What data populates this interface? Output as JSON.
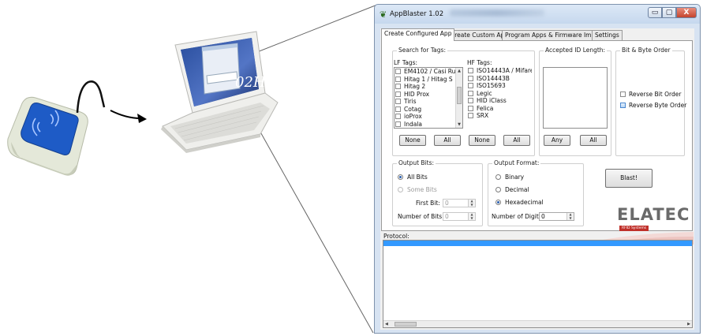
{
  "window": {
    "title": "AppBlaster 1.02",
    "controls": {
      "minimize": "▭",
      "maximize": "▢",
      "close": "X"
    }
  },
  "tabs": [
    {
      "label": "Create Configured App",
      "active": true
    },
    {
      "label": "Create Custom App",
      "active": false
    },
    {
      "label": "Program Apps & Firmware Images",
      "active": false
    },
    {
      "label": "Settings",
      "active": false
    }
  ],
  "search_tags": {
    "group_label": "Search for Tags:",
    "lf": {
      "label": "LF Tags:",
      "items": [
        "EM4102 / Casi Ru",
        "Hitag 1 / Hitag S",
        "Hitag 2",
        "HID Prox",
        "Tiris",
        "Cotag",
        "ioProx",
        "Indala"
      ],
      "buttons": {
        "none": "None",
        "all": "All"
      }
    },
    "hf": {
      "label": "HF Tags:",
      "items": [
        "ISO14443A / Mifare",
        "ISO14443B",
        "ISO15693",
        "Legic",
        "HID iClass",
        "Felica",
        "SRX"
      ],
      "buttons": {
        "none": "None",
        "all": "All"
      }
    }
  },
  "accepted_id_length": {
    "group_label": "Accepted ID Length:",
    "buttons": {
      "any": "Any",
      "all": "All"
    }
  },
  "bit_byte_order": {
    "group_label": "Bit & Byte Order",
    "options": [
      "Reverse Bit Order",
      "Reverse Byte Order"
    ]
  },
  "output_bits": {
    "group_label": "Output Bits:",
    "options": [
      {
        "label": "All Bits",
        "selected": true,
        "enabled": true
      },
      {
        "label": "Some Bits",
        "selected": false,
        "enabled": false
      }
    ],
    "first_bit": {
      "label": "First Bit:",
      "value": "0"
    },
    "number_of_bits": {
      "label": "Number of Bits:",
      "value": "0"
    }
  },
  "output_format": {
    "group_label": "Output Format:",
    "options": [
      {
        "label": "Binary",
        "selected": false
      },
      {
        "label": "Decimal",
        "selected": false
      },
      {
        "label": "Hexadecimal",
        "selected": true
      }
    ],
    "number_of_digits": {
      "label": "Number of Digits:",
      "value": "0"
    }
  },
  "blast_button": "Blast!",
  "logo": {
    "name": "ELATEC",
    "tagline": "RFID Systems"
  },
  "protocol": {
    "label": "Protocol:"
  },
  "laptop_screen_text": "02H",
  "colors": {
    "accent": "#3399ff",
    "logo_red": "#c0302a",
    "reader_blue": "#1e5bc6"
  }
}
